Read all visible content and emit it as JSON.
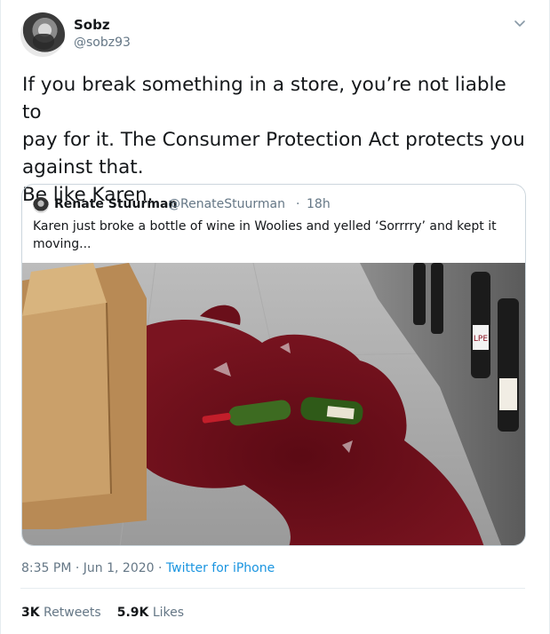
{
  "author": {
    "display_name": "Sobz",
    "handle": "@sobz93"
  },
  "tweet_text": "If you break something in a store, you’re not liable to\npay for it. The Consumer Protection Act protects you\nagainst that.\nBe like Karen.",
  "quoted_tweet": {
    "display_name": "Renate Stuurman",
    "handle": "@RenateStuurman",
    "separator": "·",
    "time": "18h",
    "text": "Karen just broke a bottle of wine in Woolies and yelled ‘Sorrrry’ and kept it moving...",
    "photo_label": "LPE"
  },
  "meta": {
    "time": "8:35 PM",
    "separator": "·",
    "date": "Jun 1, 2020",
    "separator2": "·",
    "source": "Twitter for iPhone"
  },
  "stats": {
    "retweets_count": "3K",
    "retweets_label": "Retweets",
    "likes_count": "5.9K",
    "likes_label": "Likes"
  },
  "icons": {
    "caret": "chevron-down-icon"
  },
  "colors": {
    "link": "#1b95e0",
    "secondary_text": "#657786",
    "border": "#ccd6dd"
  }
}
